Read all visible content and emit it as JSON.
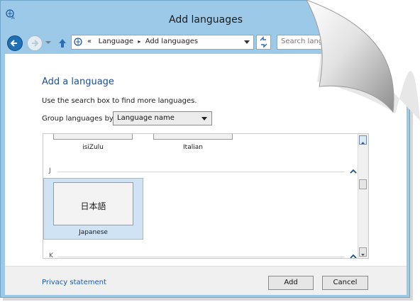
{
  "window": {
    "title": "Add languages"
  },
  "address_bar": {
    "prefix": "«",
    "crumbs": [
      "Language",
      "Add languages"
    ],
    "separator": "▸"
  },
  "search": {
    "placeholder": "Search langua"
  },
  "page": {
    "heading": "Add a language",
    "description": "Use the search box to find more languages.",
    "group_label": "Group languages by:",
    "group_value": "Language name"
  },
  "list": {
    "tiles_top": [
      {
        "name": "isiZulu"
      },
      {
        "name": "Italian"
      }
    ],
    "groups": [
      {
        "letter": "J",
        "tiles": [
          {
            "glyph": "日本語",
            "name": "Japanese",
            "selected": true
          }
        ]
      },
      {
        "letter": "K",
        "tiles": []
      }
    ]
  },
  "footer": {
    "privacy_link": "Privacy statement",
    "add_button": "Add",
    "cancel_button": "Cancel"
  },
  "colors": {
    "frame": "#9cc9e8",
    "accent": "#1e4f93",
    "selection": "#cfe3f5"
  },
  "icons": [
    "language-icon",
    "back-arrow-icon",
    "forward-arrow-icon",
    "up-arrow-icon",
    "refresh-icon",
    "chevron-up-icon",
    "scroll-up-icon",
    "scroll-down-icon",
    "dropdown-arrow-icon"
  ]
}
